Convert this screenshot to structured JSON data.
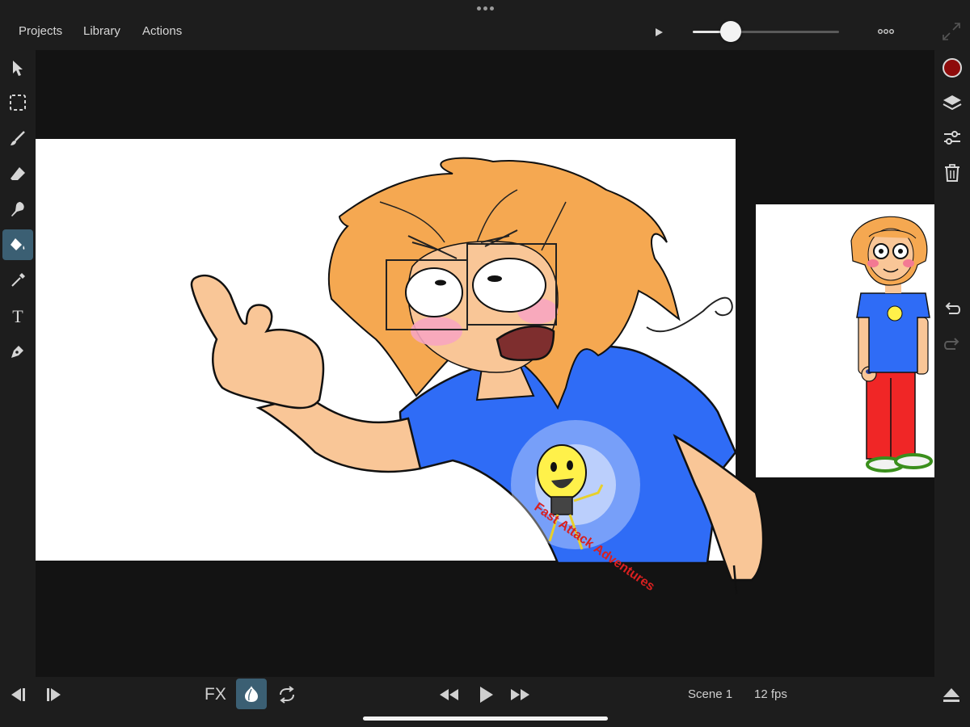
{
  "top_menu": {
    "projects": "Projects",
    "library": "Library",
    "actions": "Actions"
  },
  "playback_slider": {
    "position_fraction": 0.26
  },
  "colors": {
    "accent_active": "#3b5f73",
    "current_color": "#8e0b0b",
    "background": "#1d1d1d",
    "stage": "#131313"
  },
  "left_tools": [
    {
      "name": "select-arrow-icon"
    },
    {
      "name": "marquee-select-icon"
    },
    {
      "name": "brush-icon"
    },
    {
      "name": "eraser-icon"
    },
    {
      "name": "smudge-icon"
    },
    {
      "name": "paint-bucket-icon",
      "active": true
    },
    {
      "name": "eyedropper-icon"
    },
    {
      "name": "text-icon"
    },
    {
      "name": "pen-icon"
    }
  ],
  "right_tools": [
    {
      "name": "color-swatch"
    },
    {
      "name": "layers-icon"
    },
    {
      "name": "adjustments-icon"
    },
    {
      "name": "trash-icon"
    },
    {
      "name": "undo-icon"
    },
    {
      "name": "redo-icon"
    }
  ],
  "bottom_bar": {
    "fx_label": "FX",
    "scene_label": "Scene 1",
    "fps_label": "12 fps"
  },
  "artwork": {
    "shirt_logo_text": "Fast Attack Adventures"
  }
}
